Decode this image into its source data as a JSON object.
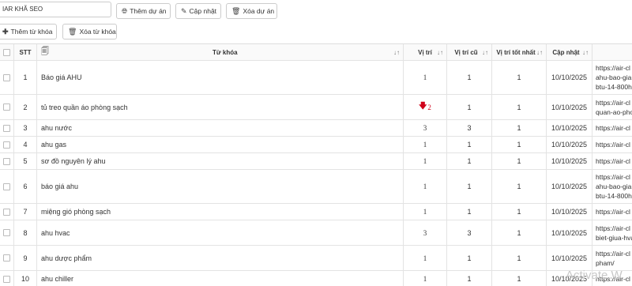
{
  "toolbar": {
    "project_select_value": "IAR KHÃ SEO",
    "add_project_label": "Thêm dự án",
    "update_label": "Cập nhật",
    "delete_project_label": "Xóa dự án",
    "add_keyword_label": "Thêm từ khóa",
    "delete_keyword_label": "Xóa từ khóa"
  },
  "icons": {
    "globe": "globe-icon",
    "edit": "edit-icon",
    "trash": "trash-icon",
    "plus": "plus-icon",
    "document": "document-icon",
    "sort": "sort-icon",
    "arrow_down": "arrow-down-icon"
  },
  "colors": {
    "drop_indicator": "#d0021b"
  },
  "table": {
    "headers": {
      "stt": "STT",
      "keyword": "Từ khóa",
      "position": "Vị trí",
      "old_position": "Vị trí cũ",
      "best_position": "Vị trí tốt nhất",
      "updated": "Cập nhật"
    },
    "rows": [
      {
        "stt": "1",
        "keyword": "Báo giá AHU",
        "position": "1",
        "old": "1",
        "best": "1",
        "date": "10/10/2025",
        "url": "https://air-cl\nahu-bao-gia\nbtu-14-800h"
      },
      {
        "stt": "2",
        "keyword": "tủ treo quần áo phòng sạch",
        "position": "2",
        "old": "1",
        "best": "1",
        "date": "10/10/2025",
        "url": "https://air-cl\nquan-ao-pho"
      },
      {
        "stt": "3",
        "keyword": "ahu nước",
        "position": "3",
        "old": "3",
        "best": "1",
        "date": "10/10/2025",
        "url": "https://air-cl"
      },
      {
        "stt": "4",
        "keyword": "ahu gas",
        "position": "1",
        "old": "1",
        "best": "1",
        "date": "10/10/2025",
        "url": "https://air-cl"
      },
      {
        "stt": "5",
        "keyword": "sơ đồ nguyên lý ahu",
        "position": "1",
        "old": "1",
        "best": "1",
        "date": "10/10/2025",
        "url": "https://air-cl"
      },
      {
        "stt": "6",
        "keyword": "báo giá ahu",
        "position": "1",
        "old": "1",
        "best": "1",
        "date": "10/10/2025",
        "url": "https://air-cl\nahu-bao-gia\nbtu-14-800h"
      },
      {
        "stt": "7",
        "keyword": "miệng gió phòng sạch",
        "position": "1",
        "old": "1",
        "best": "1",
        "date": "10/10/2025",
        "url": "https://air-cl"
      },
      {
        "stt": "8",
        "keyword": "ahu hvac",
        "position": "3",
        "old": "3",
        "best": "1",
        "date": "10/10/2025",
        "url": "https://air-cl\nbiet-giua-hva"
      },
      {
        "stt": "9",
        "keyword": "ahu dược phẩm",
        "position": "1",
        "old": "1",
        "best": "1",
        "date": "10/10/2025",
        "url": "https://air-cl\npham/"
      },
      {
        "stt": "10",
        "keyword": "ahu chiller",
        "position": "1",
        "old": "1",
        "best": "1",
        "date": "10/10/2025",
        "url": "https://air-cl"
      }
    ]
  },
  "watermark": "Activate W"
}
